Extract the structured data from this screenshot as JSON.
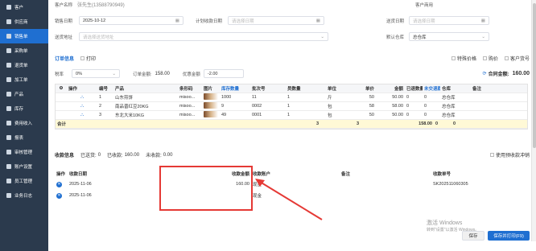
{
  "sidebar": {
    "items": [
      {
        "label": "客户",
        "active": false
      },
      {
        "label": "供应商",
        "active": false
      },
      {
        "label": "销售单",
        "active": true
      },
      {
        "label": "采购单",
        "active": false
      },
      {
        "label": "退货单",
        "active": false
      },
      {
        "label": "加工单",
        "active": false
      },
      {
        "label": "产品",
        "active": false
      },
      {
        "label": "库存",
        "active": false
      },
      {
        "label": "费用收入",
        "active": false
      },
      {
        "label": "报表",
        "active": false
      },
      {
        "label": "审核管理",
        "active": false
      },
      {
        "label": "账户设置",
        "active": false
      },
      {
        "label": "员工管理",
        "active": false
      },
      {
        "label": "业务日志",
        "active": false
      }
    ]
  },
  "form": {
    "top_customer_label": "客户名称",
    "top_customer_value": "张先生(13588790949)",
    "top_right_label": "客户商用",
    "sale_date_label": "销售日期",
    "sale_date_value": "2025-10-12",
    "plan_receipt_label": "计划收款日期",
    "plan_receipt_placeholder": "请选择日期",
    "ship_date_label": "送货日期",
    "ship_date_placeholder": "请选择日期",
    "address_label": "送货地址",
    "address_placeholder": "请选择送货地址",
    "warehouse_label": "默认仓库",
    "warehouse_value": "总仓库"
  },
  "order": {
    "title": "订单信息",
    "print_label": "打印",
    "tax_label": "税率",
    "tax_value": "0%",
    "amount_label": "订单金额:",
    "amount_value": "158.00",
    "discount_label": "优惠金额",
    "discount_value": "-2.00",
    "opt_special": "特殊价格",
    "opt_price": "购价",
    "opt_customer_no": "客户货号",
    "total_label": "合同金额:",
    "total_value": "160.00"
  },
  "table": {
    "headers": [
      "操作",
      "编号",
      "产品",
      "条形码",
      "图片",
      "库存数量",
      "批次号",
      "员数量",
      "单位",
      "单价",
      "金额",
      "已退数量",
      "未交退款",
      "仓库",
      "备注"
    ],
    "rows": [
      {
        "no": "1",
        "product": "山东煎饼",
        "barcode": "misoo...",
        "stock": "1000",
        "batch": "11",
        "qty": "1",
        "unit": "斤",
        "price": "50",
        "amount": "50.00",
        "returned": "0",
        "pending": "0",
        "warehouse": "总仓库"
      },
      {
        "no": "2",
        "product": "南品晋红豆20KG",
        "barcode": "misoo...",
        "stock": "9",
        "batch": "0002",
        "qty": "1",
        "unit": "包",
        "price": "58",
        "amount": "58.00",
        "returned": "0",
        "pending": "0",
        "warehouse": "总仓库"
      },
      {
        "no": "3",
        "product": "东北大米10KG",
        "barcode": "misoo...",
        "stock": "49",
        "batch": "0001",
        "qty": "1",
        "unit": "包",
        "price": "50",
        "amount": "50.00",
        "returned": "0",
        "pending": "0",
        "warehouse": "总仓库"
      }
    ],
    "total": {
      "label": "合计",
      "qty": "3",
      "pending": "3",
      "amount": "158.00",
      "returned": "0",
      "pend2": "0"
    }
  },
  "payment": {
    "title": "收款信息",
    "received_label": "已送货:",
    "received_value": "0",
    "collected_label": "已收款:",
    "collected_value": "160.00",
    "uncollected_label": "未收款:",
    "uncollected_value": "0.00",
    "use_balance": "使用预收款冲销",
    "headers": {
      "op": "操作",
      "date": "收款日期",
      "amount": "收款金额",
      "account": "收款账户",
      "note": "备注",
      "receipt": "收款单号"
    },
    "rows": [
      {
        "date": "2025-11-06",
        "amount": "160.00",
        "account": "现金",
        "note": "",
        "receipt": "SK202511060305"
      },
      {
        "date": "2025-11-06",
        "amount": "",
        "account": "现金",
        "note": "",
        "receipt": ""
      }
    ]
  },
  "footer": {
    "save": "保存",
    "save_print": "保存并打印(F9)"
  },
  "watermark": {
    "line1": "激活 Windows",
    "line2": "转到\"设置\"以激活 Windows。"
  }
}
